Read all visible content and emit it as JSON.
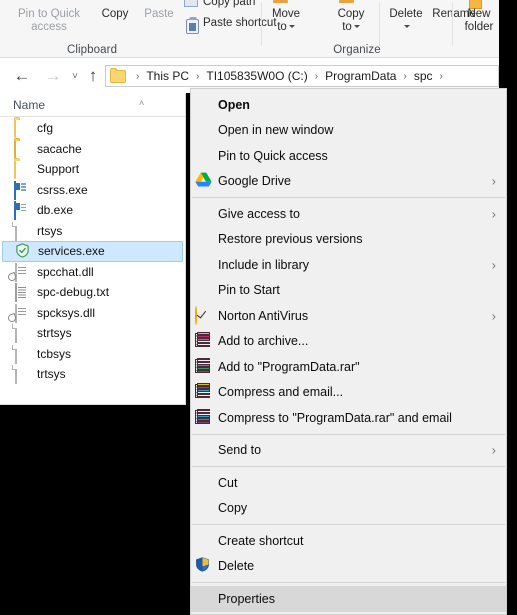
{
  "ribbon": {
    "clipboard": {
      "group_label": "Clipboard",
      "pin_to_quick_access": "Pin to Quick\naccess",
      "pin_line1": "Pin to Quick",
      "pin_line2": "access",
      "copy": "Copy",
      "paste": "Paste",
      "copy_path": "Copy path",
      "paste_shortcut": "Paste shortcut"
    },
    "organize": {
      "group_label": "Organize",
      "move_to_line1": "Move",
      "move_to_line2": "to",
      "copy_to_line1": "Copy",
      "copy_to_line2": "to",
      "delete": "Delete",
      "rename": "Rename"
    },
    "new": {
      "new_folder_line1": "New",
      "new_folder_line2": "folder"
    }
  },
  "addressbar": {
    "back": "←",
    "forward": "→",
    "recent": "˅",
    "up": "↑",
    "crumbs": [
      "This PC",
      "TI105835W0O (C:)",
      "ProgramData",
      "spc"
    ],
    "separator": "›"
  },
  "filepane": {
    "column_header": "Name",
    "sort_indicator": "˄",
    "items": [
      {
        "name": "cfg",
        "icon": "folder-icon",
        "selected": false
      },
      {
        "name": "sacache",
        "icon": "folder-icon-full",
        "selected": false
      },
      {
        "name": "Support",
        "icon": "folder-icon",
        "selected": false
      },
      {
        "name": "csrss.exe",
        "icon": "application-icon",
        "selected": false
      },
      {
        "name": "db.exe",
        "icon": "application-icon",
        "selected": false
      },
      {
        "name": "rtsys",
        "icon": "file-icon",
        "selected": false
      },
      {
        "name": "services.exe",
        "icon": "green-shield-icon",
        "selected": true
      },
      {
        "name": "spcchat.dll",
        "icon": "dll-icon",
        "selected": false
      },
      {
        "name": "spc-debug.txt",
        "icon": "text-file-icon",
        "selected": false
      },
      {
        "name": "spcksys.dll",
        "icon": "dll-icon",
        "selected": false
      },
      {
        "name": "strtsys",
        "icon": "file-icon",
        "selected": false
      },
      {
        "name": "tcbsys",
        "icon": "file-icon",
        "selected": false
      },
      {
        "name": "trtsys",
        "icon": "file-icon",
        "selected": false
      }
    ]
  },
  "context_menu": {
    "submenu_arrow": "›",
    "items": [
      {
        "label": "Open",
        "icon": null,
        "bold": true,
        "arrow": false,
        "highlighted": false,
        "separator_after": false
      },
      {
        "label": "Open in new window",
        "icon": null,
        "bold": false,
        "arrow": false,
        "highlighted": false,
        "separator_after": false
      },
      {
        "label": "Pin to Quick access",
        "icon": null,
        "bold": false,
        "arrow": false,
        "highlighted": false,
        "separator_after": false
      },
      {
        "label": "Google Drive",
        "icon": "gdrive-icon",
        "bold": false,
        "arrow": true,
        "highlighted": false,
        "separator_after": true
      },
      {
        "label": "Give access to",
        "icon": null,
        "bold": false,
        "arrow": true,
        "highlighted": false,
        "separator_after": false
      },
      {
        "label": "Restore previous versions",
        "icon": null,
        "bold": false,
        "arrow": false,
        "highlighted": false,
        "separator_after": false
      },
      {
        "label": "Include in library",
        "icon": null,
        "bold": false,
        "arrow": true,
        "highlighted": false,
        "separator_after": false
      },
      {
        "label": "Pin to Start",
        "icon": null,
        "bold": false,
        "arrow": false,
        "highlighted": false,
        "separator_after": false
      },
      {
        "label": "Norton AntiVirus",
        "icon": "norton-icon",
        "bold": false,
        "arrow": true,
        "highlighted": false,
        "separator_after": false
      },
      {
        "label": "Add to archive...",
        "icon": "winrar-icon",
        "bold": false,
        "arrow": false,
        "highlighted": false,
        "separator_after": false
      },
      {
        "label": "Add to \"ProgramData.rar\"",
        "icon": "winrar-icon",
        "bold": false,
        "arrow": false,
        "highlighted": false,
        "separator_after": false
      },
      {
        "label": "Compress and email...",
        "icon": "winrar-icon",
        "bold": false,
        "arrow": false,
        "highlighted": false,
        "separator_after": false
      },
      {
        "label": "Compress to \"ProgramData.rar\" and email",
        "icon": "winrar-icon",
        "bold": false,
        "arrow": false,
        "highlighted": false,
        "separator_after": true
      },
      {
        "label": "Send to",
        "icon": null,
        "bold": false,
        "arrow": true,
        "highlighted": false,
        "separator_after": true
      },
      {
        "label": "Cut",
        "icon": null,
        "bold": false,
        "arrow": false,
        "highlighted": false,
        "separator_after": false
      },
      {
        "label": "Copy",
        "icon": null,
        "bold": false,
        "arrow": false,
        "highlighted": false,
        "separator_after": true
      },
      {
        "label": "Create shortcut",
        "icon": null,
        "bold": false,
        "arrow": false,
        "highlighted": false,
        "separator_after": false
      },
      {
        "label": "Delete",
        "icon": "uac-shield-icon",
        "bold": false,
        "arrow": false,
        "highlighted": false,
        "separator_after": true
      },
      {
        "label": "Properties",
        "icon": null,
        "bold": false,
        "arrow": false,
        "highlighted": true,
        "separator_after": false
      }
    ]
  },
  "colors": {
    "selection_blue": "#cde8ff",
    "menu_bg": "#f0f0f0",
    "menu_highlight": "#d8d8d8",
    "folder_yellow": "#fbd572",
    "ribbon_bg": "#f6f6f6"
  }
}
